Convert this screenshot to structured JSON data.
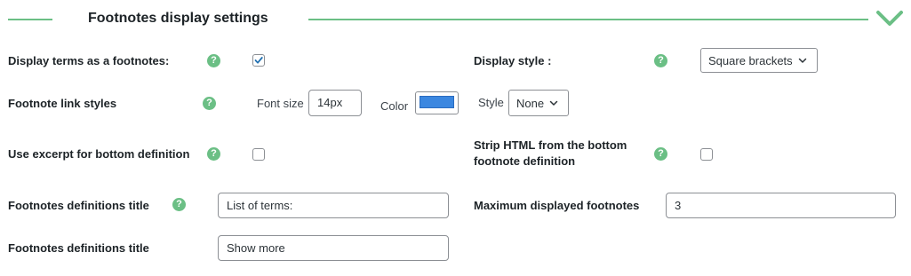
{
  "section": {
    "title": "Footnotes display settings"
  },
  "rows": {
    "display_terms": {
      "label": "Display terms as a footnotes:",
      "checked": true
    },
    "display_style": {
      "label": "Display style :",
      "selected": "Square brackets"
    },
    "link_styles": {
      "label": "Footnote link styles",
      "font_size_label": "Font size",
      "font_size_value": "14px",
      "color_label": "Color",
      "color_value": "#3b87e0",
      "style_label": "Style",
      "style_selected": "None"
    },
    "use_excerpt": {
      "label": "Use excerpt for bottom definition",
      "checked": false
    },
    "strip_html": {
      "label": "Strip HTML from the bottom footnote definition",
      "checked": false
    },
    "definitions_title": {
      "label": "Footnotes definitions title",
      "value": "List of terms:"
    },
    "max_displayed": {
      "label": "Maximum displayed footnotes",
      "value": "3"
    },
    "show_more_title": {
      "label": "Footnotes definitions title",
      "value": "Show more"
    }
  },
  "icons": {
    "help": "question-mark-icon",
    "collapse": "chevron-down-icon",
    "help_glyph": "?"
  },
  "colors": {
    "accent": "#6bbf85",
    "help_bg": "#6bbf85",
    "border": "#8c8f94"
  }
}
